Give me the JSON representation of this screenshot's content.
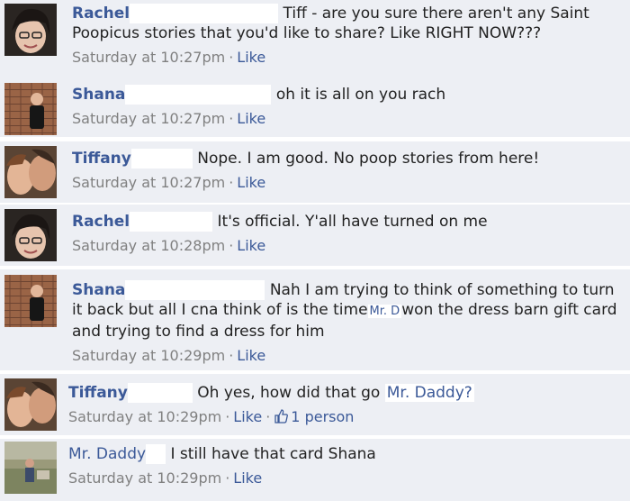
{
  "comments": [
    {
      "author": "Rachel",
      "text": "Tiff - are you sure there aren't any Saint Poopicus stories that you'd like to share? Like RIGHT NOW???",
      "time": "Saturday at 10:27pm",
      "like": "Like"
    },
    {
      "author": "Shana",
      "text": "oh it is all on you rach",
      "time": "Saturday at 10:27pm",
      "like": "Like"
    },
    {
      "author": "Tiffany",
      "text": "Nope. I am good. No poop stories from here!",
      "time": "Saturday at 10:27pm",
      "like": "Like"
    },
    {
      "author": "Rachel",
      "text": "It's official. Y'all have turned on me",
      "time": "Saturday at 10:28pm",
      "like": "Like"
    },
    {
      "author": "Shana",
      "text_before": "Nah I am trying to think of something to turn it back but all I cna think of is the time",
      "tag": "Mr. D",
      "text_after": "won the dress barn gift card and trying to find a dress for him",
      "time": "Saturday at 10:29pm",
      "like": "Like"
    },
    {
      "author": "Tiffany",
      "text_before": "Oh yes, how did that go",
      "tag": "Mr. Daddy?",
      "time": "Saturday at 10:29pm",
      "like": "Like",
      "likes_count": "1 person"
    },
    {
      "author": "Mr. Daddy",
      "text": "I still have that card Shana",
      "time": "Saturday at 10:29pm",
      "like": "Like"
    }
  ],
  "icons": {
    "thumbs_up": "thumbs-up-icon"
  },
  "colors": {
    "background": "#edeff4",
    "link": "#3b5998",
    "meta": "#808080"
  }
}
